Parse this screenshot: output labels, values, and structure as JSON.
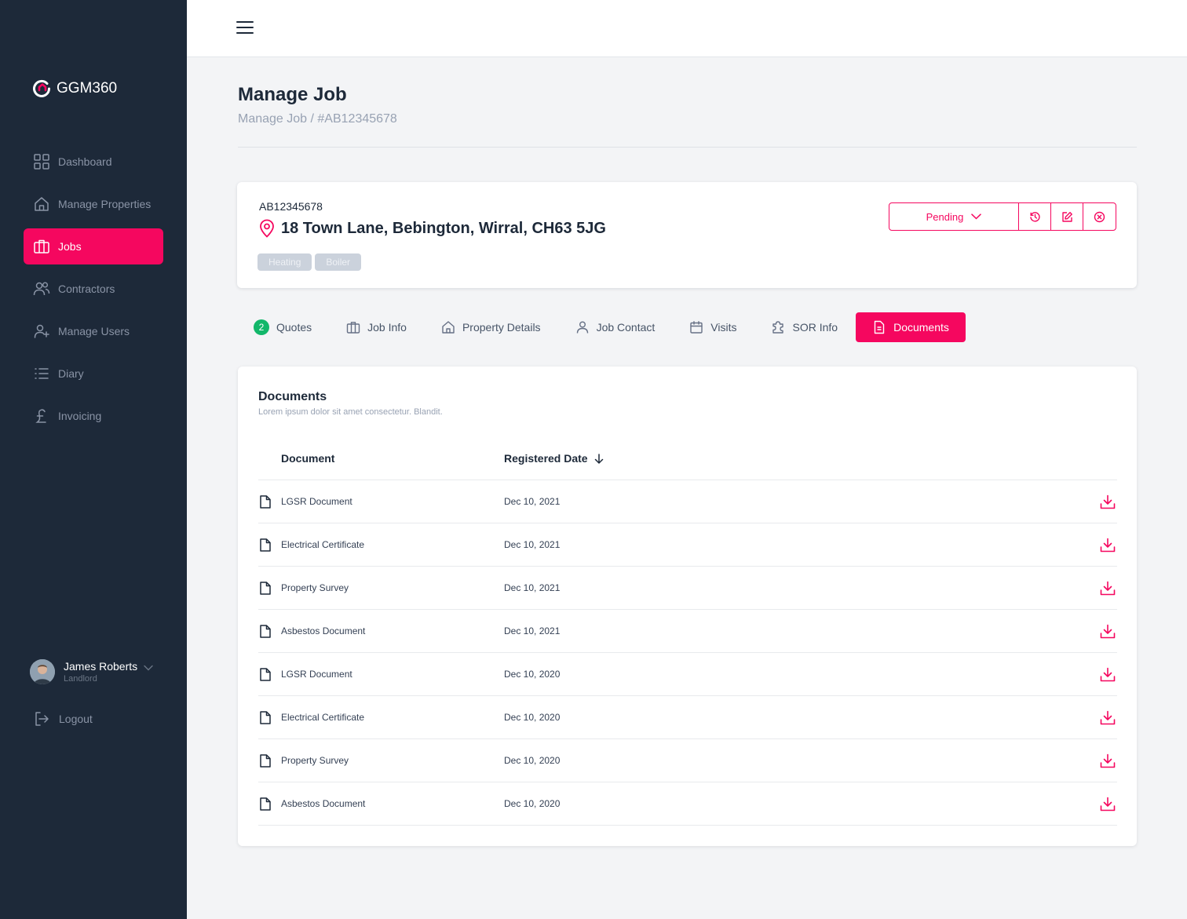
{
  "app": {
    "brand": "GGM360",
    "accent_color": "#f5075f",
    "sidebar_color": "#1d2939"
  },
  "sidebar": {
    "items": [
      {
        "label": "Dashboard",
        "icon": "grid-icon"
      },
      {
        "label": "Manage Properties",
        "icon": "home-icon"
      },
      {
        "label": "Jobs",
        "icon": "briefcase-icon",
        "active": true
      },
      {
        "label": "Contractors",
        "icon": "users-icon"
      },
      {
        "label": "Manage Users",
        "icon": "user-plus-icon"
      },
      {
        "label": "Diary",
        "icon": "list-icon"
      },
      {
        "label": "Invoicing",
        "icon": "pound-icon"
      }
    ],
    "user": {
      "name": "James Roberts",
      "role": "Landlord"
    },
    "logout_label": "Logout"
  },
  "header": {
    "title": "Manage Job",
    "breadcrumb": "Manage Job / #AB12345678"
  },
  "job": {
    "id": "AB12345678",
    "address": "18 Town Lane, Bebington, Wirral, CH63 5JG",
    "tags": [
      "Heating",
      "Boiler"
    ],
    "status": "Pending"
  },
  "tabs": [
    {
      "label": "Quotes",
      "badge": "2"
    },
    {
      "label": "Job Info"
    },
    {
      "label": "Property Details"
    },
    {
      "label": "Job Contact"
    },
    {
      "label": "Visits"
    },
    {
      "label": "SOR Info"
    },
    {
      "label": "Documents",
      "active": true
    }
  ],
  "documents": {
    "title": "Documents",
    "subtitle": "Lorem ipsum dolor sit amet consectetur. Blandit.",
    "columns": {
      "document": "Document",
      "date": "Registered Date"
    },
    "rows": [
      {
        "name": "LGSR Document",
        "date": "Dec 10, 2021"
      },
      {
        "name": "Electrical Certificate",
        "date": "Dec 10, 2021"
      },
      {
        "name": "Property Survey",
        "date": "Dec 10, 2021"
      },
      {
        "name": "Asbestos Document",
        "date": "Dec 10, 2021"
      },
      {
        "name": "LGSR Document",
        "date": "Dec 10, 2020"
      },
      {
        "name": "Electrical Certificate",
        "date": "Dec 10, 2020"
      },
      {
        "name": "Property Survey",
        "date": "Dec 10, 2020"
      },
      {
        "name": "Asbestos Document",
        "date": "Dec 10, 2020"
      }
    ]
  }
}
